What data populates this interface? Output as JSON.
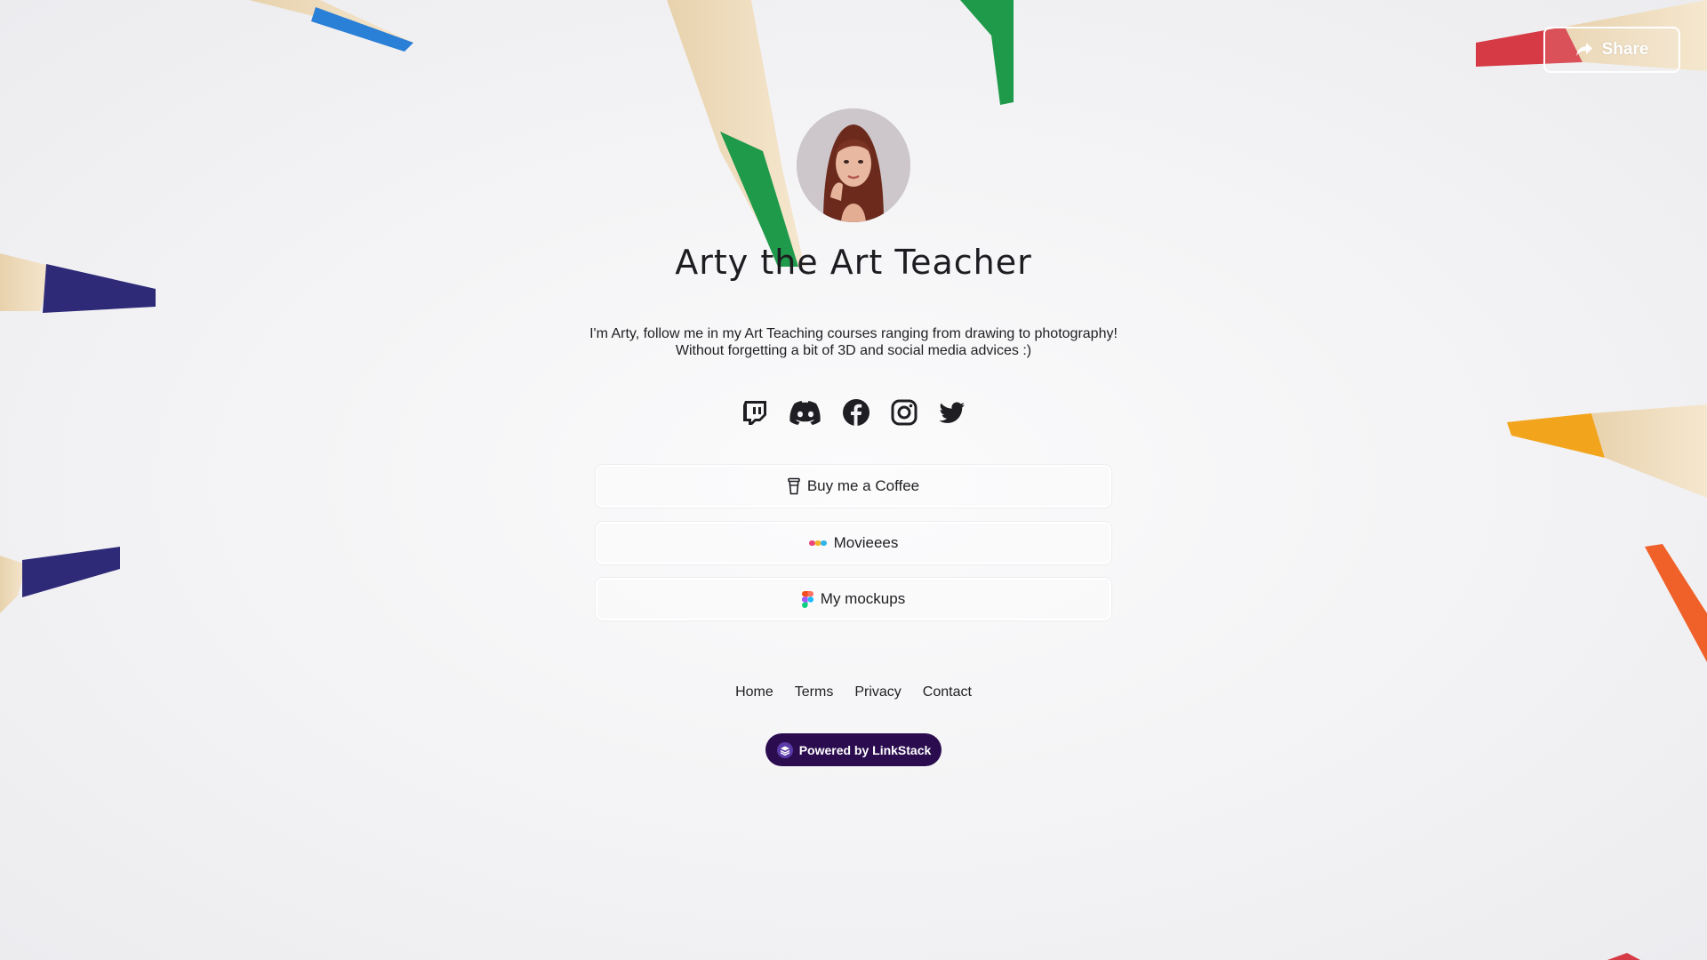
{
  "header": {
    "share_label": "Share",
    "share_icon": "share-arrow-icon"
  },
  "profile": {
    "avatar_icon": "profile-photo",
    "name": "Arty the Art Teacher",
    "bio": "I'm Arty, follow me in my Art Teaching courses ranging from drawing to photography! Without forgetting a bit of 3D and social media advices :)"
  },
  "socials": [
    {
      "name": "twitch",
      "icon": "twitch-icon"
    },
    {
      "name": "discord",
      "icon": "discord-icon"
    },
    {
      "name": "facebook",
      "icon": "facebook-icon"
    },
    {
      "name": "instagram",
      "icon": "instagram-icon"
    },
    {
      "name": "twitter",
      "icon": "twitter-icon"
    }
  ],
  "links": [
    {
      "label": "Buy me a Coffee",
      "icon": "coffee-cup-icon"
    },
    {
      "label": "Movieees",
      "icon": "dots-icon"
    },
    {
      "label": "My mockups",
      "icon": "figma-icon"
    }
  ],
  "footer": {
    "home": "Home",
    "terms": "Terms",
    "privacy": "Privacy",
    "contact": "Contact"
  },
  "badge": {
    "label": "Powered by LinkStack",
    "icon": "linkstack-logo-icon"
  },
  "colors": {
    "badge_bg": "#2b0d4f",
    "pencil_green": "#1f9a4a",
    "pencil_blue": "#2a7fd6",
    "pencil_navy": "#2e2a78",
    "pencil_red": "#d63a44",
    "pencil_yellow": "#f2a51c",
    "pencil_orange": "#f0612a"
  }
}
